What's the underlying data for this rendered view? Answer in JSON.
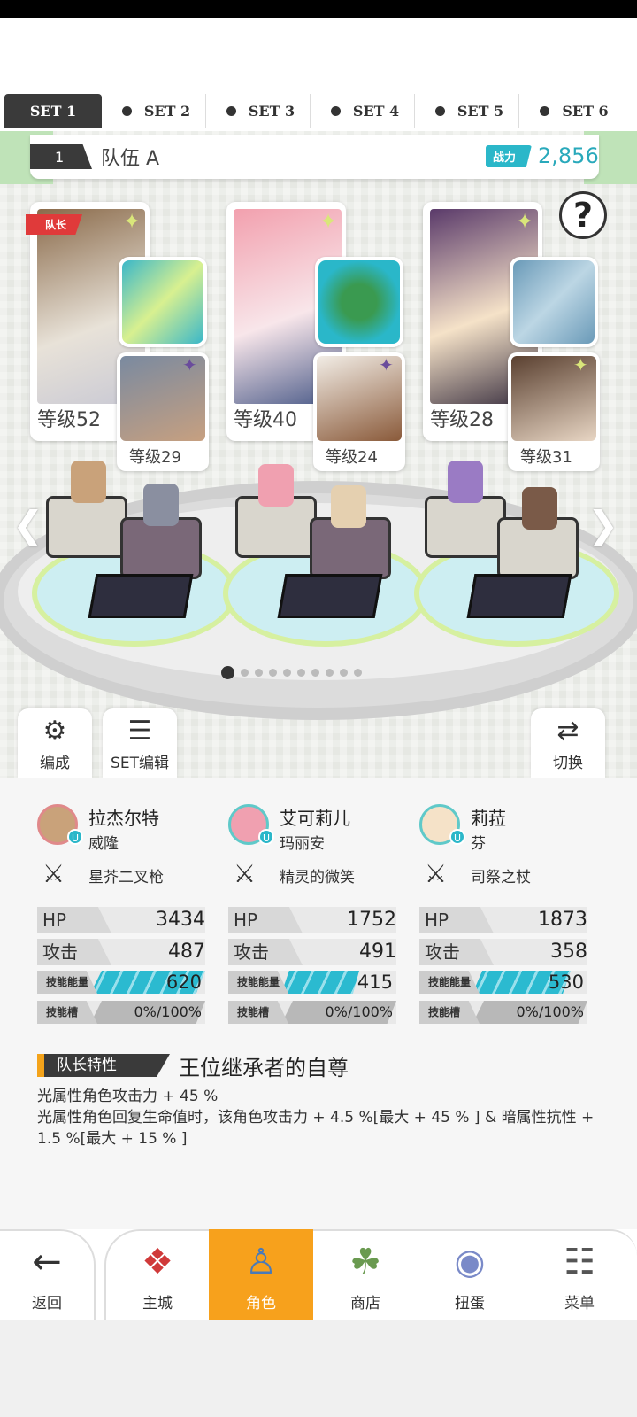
{
  "set_tabs": [
    {
      "label": "SET 1",
      "active": true
    },
    {
      "label": "SET 2",
      "active": false
    },
    {
      "label": "SET 3",
      "active": false
    },
    {
      "label": "SET 4",
      "active": false
    },
    {
      "label": "SET 5",
      "active": false
    },
    {
      "label": "SET 6",
      "active": false
    }
  ],
  "team": {
    "number": "1",
    "name": "队伍 A",
    "power_label": "战力",
    "power_value": "2,856"
  },
  "help_icon": "?",
  "leader_badge": "队长",
  "cards": [
    {
      "main_level": "等级52",
      "sub_level": "等级29"
    },
    {
      "main_level": "等级40",
      "sub_level": "等级24"
    },
    {
      "main_level": "等级28",
      "sub_level": "等级31"
    }
  ],
  "pager": {
    "count": 10,
    "current": 1
  },
  "controls": {
    "formation": "编成",
    "set_edit": "SET编辑",
    "switch": "切换"
  },
  "characters": [
    {
      "name": "拉杰尔特",
      "sub": "威隆",
      "weapon": "星芥二叉枪",
      "hp_label": "HP",
      "hp": "3434",
      "atk_label": "攻击",
      "atk": "487",
      "energy_label": "技能能量",
      "energy": "620",
      "energy_pct": 0.62,
      "slot_label": "技能槽",
      "slot": "0%/100%",
      "avatar_color": "#e0898a"
    },
    {
      "name": "艾可莉儿",
      "sub": "玛丽安",
      "weapon": "精灵的微笑",
      "hp_label": "HP",
      "hp": "1752",
      "atk_label": "攻击",
      "atk": "491",
      "energy_label": "技能能量",
      "energy": "415",
      "energy_pct": 0.42,
      "slot_label": "技能槽",
      "slot": "0%/100%",
      "avatar_color": "#5fc9c9"
    },
    {
      "name": "莉菈",
      "sub": "芬",
      "weapon": "司祭之杖",
      "hp_label": "HP",
      "hp": "1873",
      "atk_label": "攻击",
      "atk": "358",
      "energy_label": "技能能量",
      "energy": "530",
      "energy_pct": 0.53,
      "slot_label": "技能槽",
      "slot": "0%/100%",
      "avatar_color": "#5fc9c9"
    }
  ],
  "leader_trait": {
    "label": "队长特性",
    "name": "王位继承者的自尊",
    "line1": "光属性角色攻击力 + 45 %",
    "line2": "光属性角色回复生命值时，该角色攻击力 + 4.5 %[最大 + 45 % ] & 暗属性抗性 + 1.5 %[最大 + 15 % ]"
  },
  "nav": [
    {
      "label": "返回",
      "icon": "back-arrow-icon",
      "active": false
    },
    {
      "label": "主城",
      "icon": "castle-icon",
      "active": false
    },
    {
      "label": "角色",
      "icon": "character-icon",
      "active": true
    },
    {
      "label": "商店",
      "icon": "shop-icon",
      "active": false
    },
    {
      "label": "扭蛋",
      "icon": "gacha-icon",
      "active": false
    },
    {
      "label": "菜单",
      "icon": "menu-icon",
      "active": false
    }
  ],
  "colors": {
    "accent": "#2bb7c9",
    "nav_active": "#f7a11c",
    "leader_red": "#e03a3a",
    "dark": "#3a3a3a"
  }
}
